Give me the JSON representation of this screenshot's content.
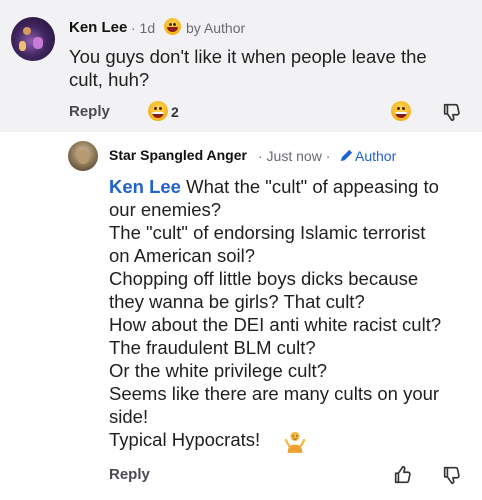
{
  "comment": {
    "username": "Ken Lee",
    "time": "· 1d",
    "reaction_badge_label": "by Author",
    "text_lines": [
      "You guys don't like it when people leave the",
      "cult, huh?"
    ],
    "reply_label": "Reply",
    "reaction_count": "2",
    "reaction_icon": "grinning-face-icon"
  },
  "reply": {
    "username": "Star Spangled Anger",
    "time": "· Just now ·",
    "author_badge": "Author",
    "mention": "Ken Lee",
    "text_lines": [
      "What the \"cult\" of appeasing to",
      "our enemies?",
      "The \"cult\" of endorsing Islamic terrorist",
      "on American soil?",
      "Chopping off little boys dicks because",
      "they wanna be girls?   That cult?",
      "How about the DEI anti white racist cult?",
      " The fraudulent BLM cult?",
      "Or the white privilege cult?",
      "Seems like there are many cults on your",
      "side!",
      "Typical Hypocrats!"
    ],
    "end_icon": "person-shrugging-icon",
    "reply_label": "Reply"
  },
  "colors": {
    "comment_bg": "#f2f2f4",
    "mention": "#1f62d0",
    "meta": "#6a6a72"
  }
}
